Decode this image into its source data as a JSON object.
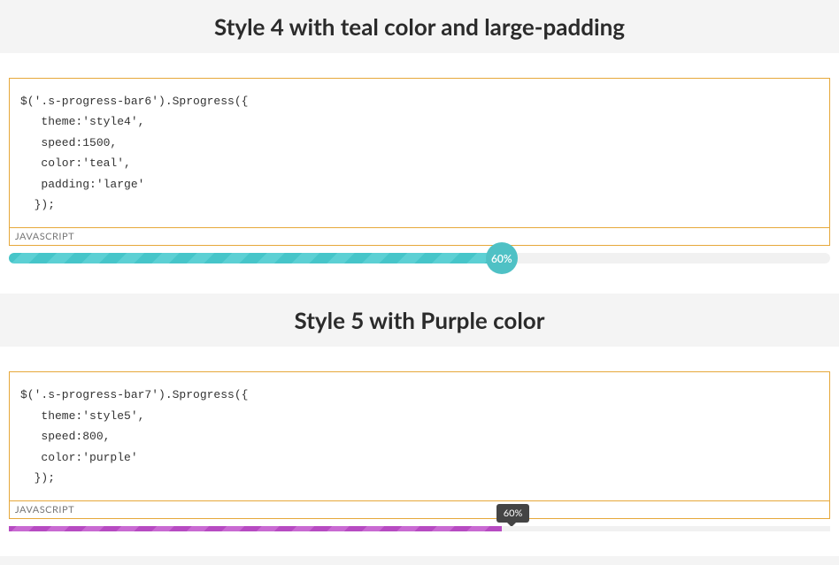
{
  "sections": [
    {
      "title": "Style 4 with teal color and large-padding",
      "code": "$('.s-progress-bar6').Sprogress({\n   theme:'style4',\n   speed:1500,\n   color:'teal',\n   padding:'large'\n  });",
      "code_label": "JAVASCRIPT",
      "progress_percent": 60,
      "progress_label": "60%",
      "bar_color": "#46c5c9"
    },
    {
      "title": "Style 5 with Purple color",
      "code": "$('.s-progress-bar7').Sprogress({\n   theme:'style5',\n   speed:800,\n   color:'purple'\n  });",
      "code_label": "JAVASCRIPT",
      "progress_percent": 60,
      "progress_label": "60%",
      "bar_color": "#b74bc2"
    }
  ]
}
